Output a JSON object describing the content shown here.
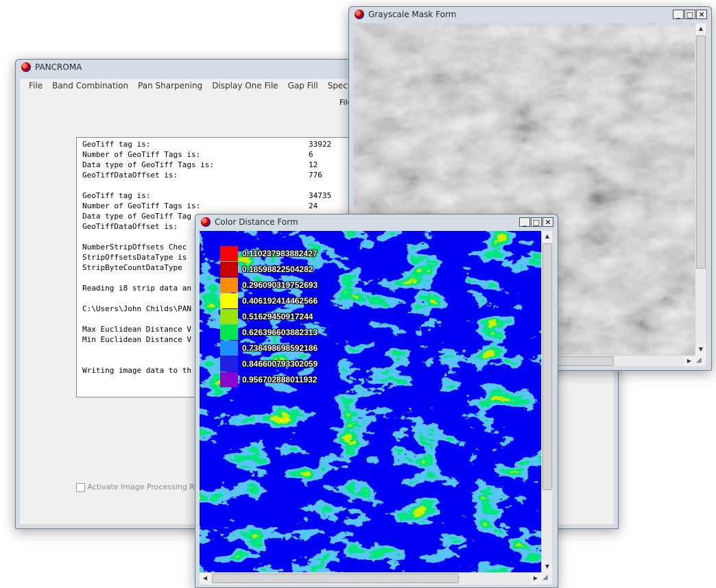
{
  "pancroma": {
    "title": "PANCROMA",
    "menu": [
      "File",
      "Band Combination",
      "Pan Sharpening",
      "Display One File",
      "Gap Fill",
      "Spectral Analy"
    ],
    "toolbar_label": "File",
    "memo_lines": [
      {
        "key": "GeoTiff tag is:",
        "value": "33922"
      },
      {
        "key": "Number of GeoTiff Tags is:",
        "value": "6"
      },
      {
        "key": "Data type of GeoTiff Tags is:",
        "value": "12"
      },
      {
        "key": "GeoTiffDataOffset is:",
        "value": "776"
      },
      {
        "key": "",
        "value": ""
      },
      {
        "key": "GeoTiff tag is:",
        "value": "34735"
      },
      {
        "key": "Number of GeoTiff Tags is:",
        "value": "24"
      },
      {
        "key": "Data type of GeoTiff Tag",
        "value": ""
      },
      {
        "key": "GeoTiffDataOffset is:",
        "value": ""
      },
      {
        "key": "",
        "value": ""
      },
      {
        "key": "NumberStripOffsets Chec",
        "value": ""
      },
      {
        "key": "StripOffsetsDataType is",
        "value": ""
      },
      {
        "key": "StripByteCountDataType",
        "value": ""
      },
      {
        "key": "",
        "value": ""
      },
      {
        "key": "Reading i8 strip data an",
        "value": ""
      },
      {
        "key": "",
        "value": ""
      },
      {
        "key": "C:\\Users\\John Childs\\PAN",
        "value": ""
      },
      {
        "key": "",
        "value": ""
      },
      {
        "key": "Max Euclidean Distance V",
        "value": ""
      },
      {
        "key": "Min Euclidean Distance V",
        "value": ""
      },
      {
        "key": "",
        "value": ""
      },
      {
        "key": "",
        "value": ""
      },
      {
        "key": "Writing image data to th",
        "value": ""
      }
    ],
    "checkbox_label": "Activate Image Processing Routi"
  },
  "grayscale": {
    "title": "Grayscale Mask Form"
  },
  "color_distance": {
    "title": "Color Distance Form",
    "legend": [
      {
        "color": "#ff0000",
        "label": "0.110237983882427"
      },
      {
        "color": "#c80000",
        "label": "0.18598822504282"
      },
      {
        "color": "#ff8c00",
        "label": "0.296090319752693"
      },
      {
        "color": "#ffff00",
        "label": "0.406192414462566"
      },
      {
        "color": "#96e600",
        "label": "0.51629450917244"
      },
      {
        "color": "#00e650",
        "label": "0.626396603882313"
      },
      {
        "color": "#1e90ff",
        "label": "0.736498698592186"
      },
      {
        "color": "#2020e6",
        "label": "0.846600793302059"
      },
      {
        "color": "#8c00d2",
        "label": "0.956702888011932"
      }
    ]
  },
  "window_controls": {
    "minimize": "_",
    "maximize": "□",
    "close": "✕"
  }
}
